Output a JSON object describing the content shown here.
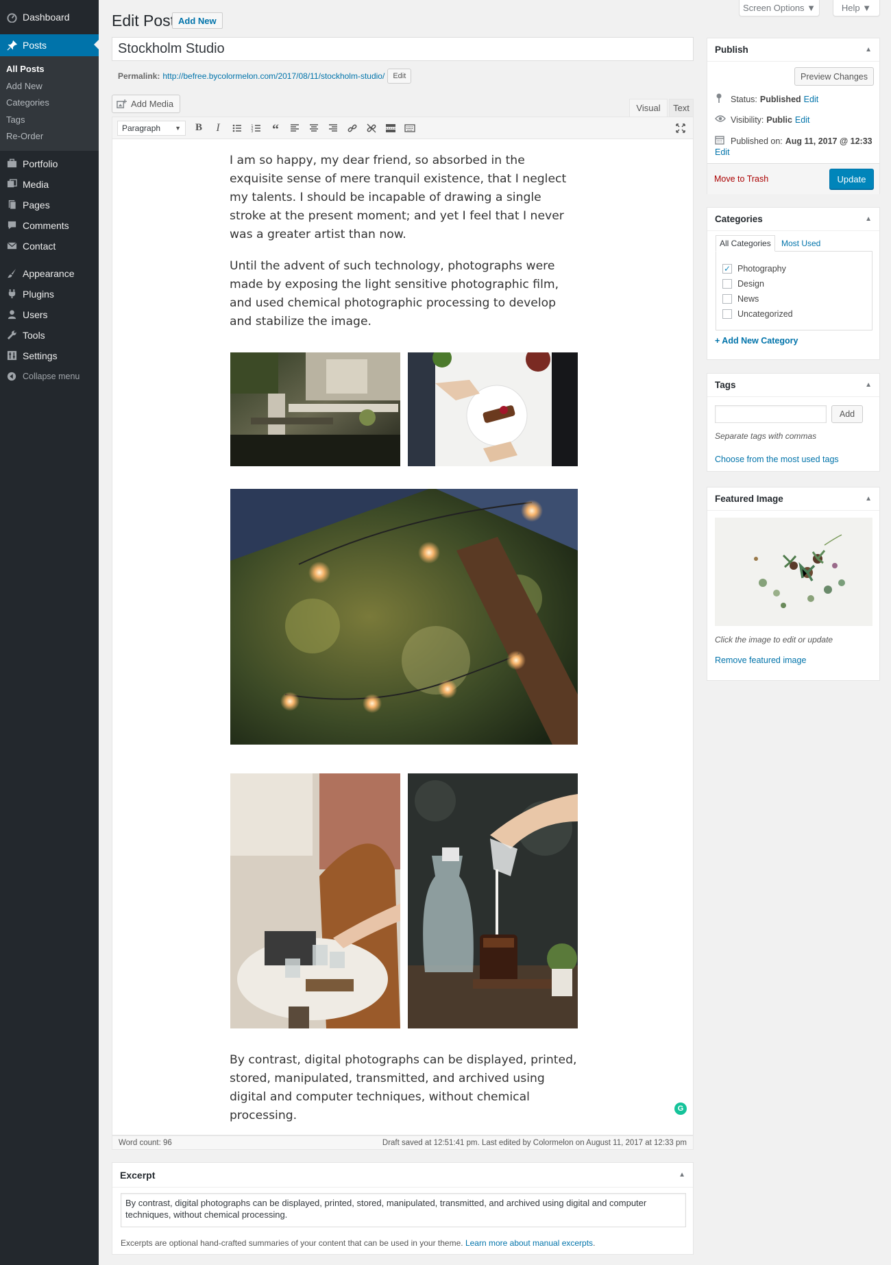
{
  "sidebar": {
    "items": [
      {
        "label": "Dashboard",
        "icon": "dashboard-icon"
      },
      {
        "label": "Posts",
        "icon": "pin-icon"
      },
      {
        "label": "Portfolio",
        "icon": "portfolio-icon"
      },
      {
        "label": "Media",
        "icon": "media-icon"
      },
      {
        "label": "Pages",
        "icon": "pages-icon"
      },
      {
        "label": "Comments",
        "icon": "comment-icon"
      },
      {
        "label": "Contact",
        "icon": "mail-icon"
      },
      {
        "label": "Appearance",
        "icon": "brush-icon"
      },
      {
        "label": "Plugins",
        "icon": "plugin-icon"
      },
      {
        "label": "Users",
        "icon": "user-icon"
      },
      {
        "label": "Tools",
        "icon": "wrench-icon"
      },
      {
        "label": "Settings",
        "icon": "settings-icon"
      },
      {
        "label": "Collapse menu",
        "icon": "collapse-icon"
      }
    ],
    "posts_submenu": [
      "All Posts",
      "Add New",
      "Categories",
      "Tags",
      "Re-Order"
    ]
  },
  "header": {
    "screen_options": "Screen Options ▼",
    "help": "Help ▼",
    "title": "Edit Post",
    "add_new": "Add New"
  },
  "post": {
    "title": "Stockholm Studio",
    "permalink_label": "Permalink:",
    "permalink_url": "http://befree.bycolormelon.com/2017/08/11/stockholm-studio/",
    "permalink_edit": "Edit"
  },
  "editor": {
    "add_media": "Add Media",
    "tab_visual": "Visual",
    "tab_text": "Text",
    "format": "Paragraph",
    "paragraphs": [
      "I am so happy, my dear friend, so absorbed in the exquisite sense of mere tranquil existence, that I neglect my talents. I should be incapable of drawing a single stroke at the present moment; and yet I feel that I never was a greater artist than now.",
      "Until the advent of such technology, photographs were made by exposing the light sensitive photographic film, and used chemical photographic processing to develop and stabilize the image.",
      "By contrast, digital photographs can be displayed, printed, stored, manipulated, transmitted, and archived using digital and computer techniques, without chemical processing."
    ],
    "word_count": "Word count: 96",
    "draft_status": "Draft saved at 12:51:41 pm. Last edited by Colormelon on August 11, 2017 at 12:33 pm"
  },
  "excerpt": {
    "title": "Excerpt",
    "value": "By contrast, digital photographs can be displayed, printed, stored, manipulated, transmitted, and archived using digital and computer techniques, without chemical processing.",
    "help": "Excerpts are optional hand-crafted summaries of your content that can be used in your theme.",
    "help_link": "Learn more about manual excerpts",
    "help_end": "."
  },
  "publish": {
    "title": "Publish",
    "preview": "Preview Changes",
    "status_label": "Status:",
    "status_value": "Published",
    "visibility_label": "Visibility:",
    "visibility_value": "Public",
    "published_label": "Published on:",
    "published_value": "Aug 11, 2017 @ 12:33",
    "edit": "Edit",
    "trash": "Move to Trash",
    "update": "Update"
  },
  "categories": {
    "title": "Categories",
    "tab_all": "All Categories",
    "tab_used": "Most Used",
    "items": [
      {
        "label": "Photography",
        "checked": true
      },
      {
        "label": "Design",
        "checked": false
      },
      {
        "label": "News",
        "checked": false
      },
      {
        "label": "Uncategorized",
        "checked": false
      }
    ],
    "add_new": "+ Add New Category"
  },
  "tags": {
    "title": "Tags",
    "input_value": "",
    "add": "Add",
    "hint": "Separate tags with commas",
    "choose": "Choose from the most used tags"
  },
  "featured_image": {
    "title": "Featured Image",
    "hint": "Click the image to edit or update",
    "remove": "Remove featured image"
  },
  "colors": {
    "sidebar_bg": "#23282d",
    "accent": "#0073aa",
    "primary_button": "#0085ba",
    "trash": "#a00"
  }
}
